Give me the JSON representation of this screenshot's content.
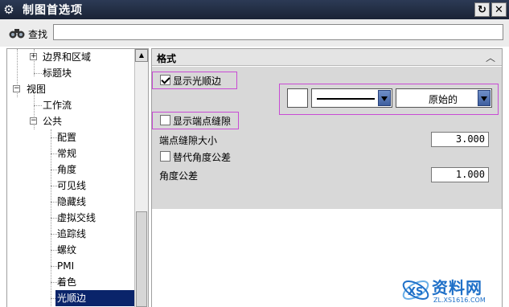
{
  "window": {
    "title": "制图首选项",
    "buttons": [
      "reset-icon",
      "close-icon"
    ]
  },
  "search": {
    "label": "查找",
    "value": "",
    "placeholder": ""
  },
  "tree": {
    "items": [
      {
        "label": "边界和区域",
        "expander": "+"
      },
      {
        "label": "标题块"
      },
      {
        "label": "视图",
        "expander": "-"
      },
      {
        "label": "工作流"
      },
      {
        "label": "公共",
        "expander": "-"
      },
      {
        "label": "配置"
      },
      {
        "label": "常规"
      },
      {
        "label": "角度"
      },
      {
        "label": "可见线"
      },
      {
        "label": "隐藏线"
      },
      {
        "label": "虚拟交线"
      },
      {
        "label": "追踪线"
      },
      {
        "label": "螺纹"
      },
      {
        "label": "PMI"
      },
      {
        "label": "着色"
      },
      {
        "label": "光顺边",
        "selected": true
      }
    ]
  },
  "format": {
    "header": "格式",
    "show_smooth_edges": {
      "label": "显示光顺边",
      "checked": true
    },
    "line_style": {
      "color": "#ffffff",
      "font": "solid-line",
      "width_value": "原始的"
    },
    "show_end_gaps": {
      "label": "显示端点缝隙",
      "checked": false
    },
    "end_gap_size": {
      "label": "端点缝隙大小",
      "value": "3.000"
    },
    "alt_angle_tolerance": {
      "label": "替代角度公差",
      "checked": false
    },
    "angle_tolerance": {
      "label": "角度公差",
      "value": "1.000"
    }
  },
  "watermark": {
    "text": "资料网",
    "url": "ZL.XS1616.COM"
  },
  "colors": {
    "titlebar": "#1f2a40",
    "selection": "#0a246a",
    "highlight_box": "#c84bd4",
    "dropdown_button": "#4f6fae"
  }
}
